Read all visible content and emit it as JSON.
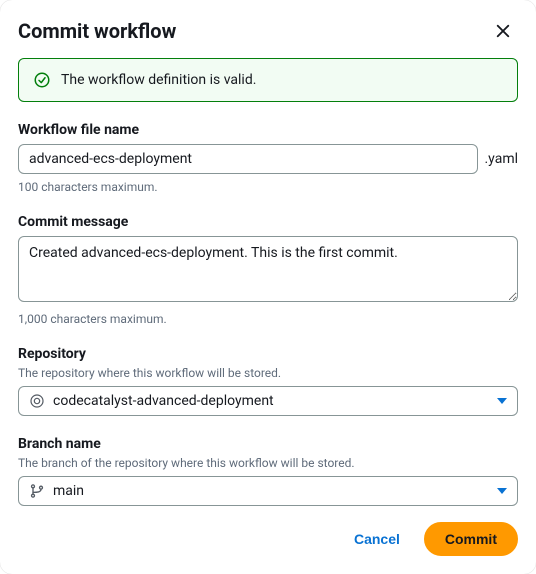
{
  "header": {
    "title": "Commit workflow"
  },
  "alert": {
    "message": "The workflow definition is valid."
  },
  "fields": {
    "filename": {
      "label": "Workflow file name",
      "value": "advanced-ecs-deployment",
      "suffix": ".yaml",
      "helper": "100 characters maximum."
    },
    "commit_message": {
      "label": "Commit message",
      "value": "Created advanced-ecs-deployment. This is the first commit.",
      "helper": "1,000 characters maximum."
    },
    "repository": {
      "label": "Repository",
      "description": "The repository where this workflow will be stored.",
      "value": "codecatalyst-advanced-deployment"
    },
    "branch": {
      "label": "Branch name",
      "description": "The branch of the repository where this workflow will be stored.",
      "value": "main"
    }
  },
  "footer": {
    "cancel": "Cancel",
    "commit": "Commit"
  }
}
